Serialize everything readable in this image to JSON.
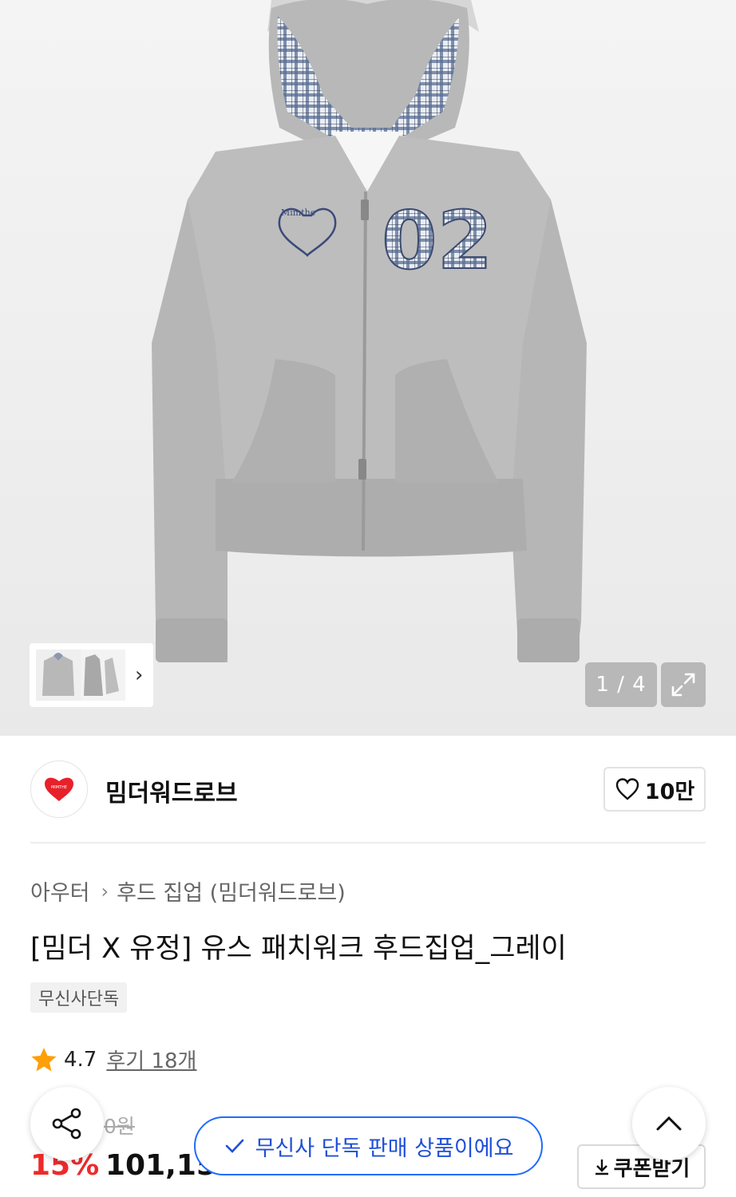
{
  "gallery": {
    "counter": "1 / 4",
    "thumbnail_count": 2
  },
  "brand": {
    "name": "밈더워드로브",
    "logo_text": "MIMTHE",
    "likes": "10만"
  },
  "product": {
    "breadcrumb": [
      "아우터",
      "후드 집업 (밈더워드로브)"
    ],
    "title": "[밈더 X 유정] 유스 패치워크 후드집업_그레이",
    "tag": "무신사단독",
    "rating": "4.7",
    "reviews": "후기 18개",
    "original_price": "0원",
    "discount": "15%",
    "sale_price": "101,150"
  },
  "toast": {
    "text": "무신사 단독 판매 상품이에요"
  },
  "coupon": {
    "label": "쿠폰받기"
  },
  "colors": {
    "discount_red": "#ee2a2a",
    "toast_blue": "#1f6bff",
    "heart_red": "#e8202a",
    "star_orange": "#ff9f0a"
  },
  "icons": {
    "expand": "expand-icon",
    "chevron": "chevron-right-icon",
    "heart": "heart-outline-icon",
    "star": "star-icon",
    "share": "share-icon",
    "up": "chevron-up-icon",
    "check": "check-icon",
    "download": "download-icon"
  }
}
